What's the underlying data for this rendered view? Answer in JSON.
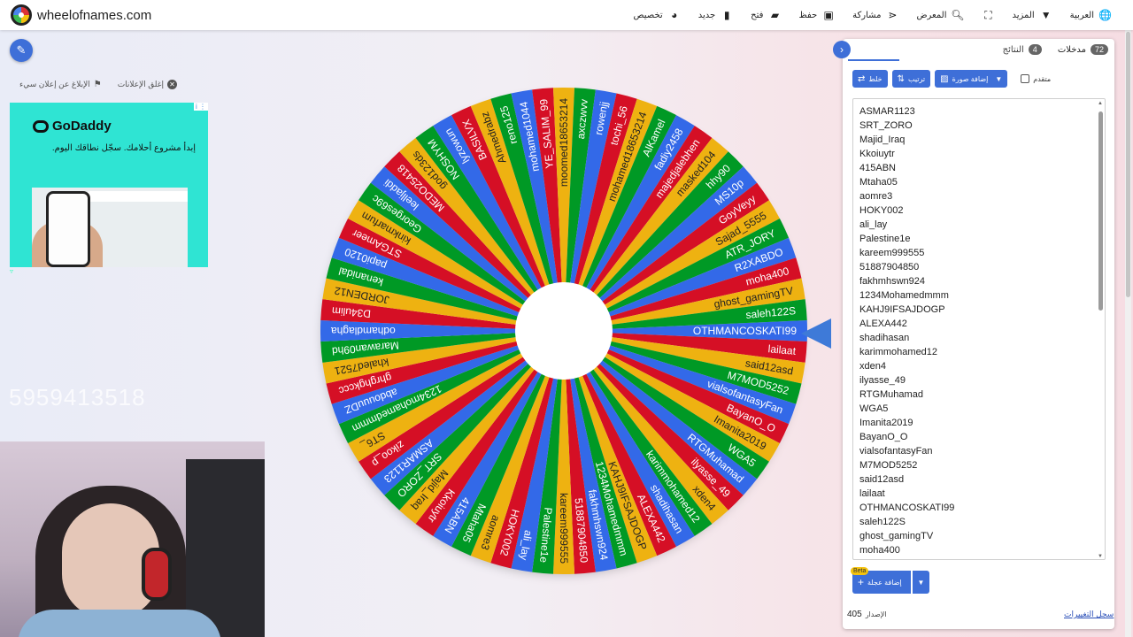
{
  "header": {
    "brand": "wheelofnames.com",
    "nav": [
      {
        "label": "العربية",
        "icon": "globe-icon",
        "dropdown": false
      },
      {
        "label": "المزيد",
        "icon": "caret-down-icon",
        "dropdown": true
      },
      {
        "label": "",
        "icon": "fullscreen-icon",
        "dropdown": false
      },
      {
        "label": "المعرض",
        "icon": "search-icon",
        "dropdown": false
      },
      {
        "label": "مشاركة",
        "icon": "share-icon",
        "dropdown": false
      },
      {
        "label": "حفظ",
        "icon": "save-icon",
        "dropdown": false
      },
      {
        "label": "فتح",
        "icon": "folder-open-icon",
        "dropdown": false
      },
      {
        "label": "جديد",
        "icon": "new-file-icon",
        "dropdown": false
      },
      {
        "label": "تخصيص",
        "icon": "palette-icon",
        "dropdown": false
      }
    ]
  },
  "left": {
    "close_ads": "إغلق الإعلانات",
    "report_ad": "الإبلاغ عن إعلان سيء",
    "ad": {
      "brand": "GoDaddy",
      "text": "إبدأ مشروع أحلامك. سجّل نطاقك اليوم.",
      "corner": "i ⋮"
    },
    "faded_number": "5959413518"
  },
  "wheel": {
    "colors": [
      "#3369e8",
      "#d50f25",
      "#eeb211",
      "#009925"
    ],
    "center_color": "#ffffff",
    "pointer_color": "#3e7ad8",
    "segments": [
      "OTHMANCOSKATI99",
      "lailaat",
      "said12asd",
      "M7MOD5252",
      "vialsofantasyFan",
      "BayanO_O",
      "Imanita2019",
      "WGA5",
      "RTGMuhamad",
      "ilyasse_49",
      "xden4",
      "karimmohamed12",
      "shadihasan",
      "ALEXA442",
      "KAHJ9IFSAJDOGP",
      "1234Mohamedmmm",
      "fakhmhswn924",
      "51887904850",
      "kareem999555",
      "Palestine1e",
      "ali_lay",
      "HOKY002",
      "aomre3",
      "Mtaha05",
      "415ABN",
      "Kkoiuytr",
      "Majid_Iraq",
      "SRT_ZORO",
      "ASMAR1123",
      "zikoo_p",
      "ST6_",
      "1234mohamedmmm",
      "abdouuuDZ",
      "ghrghgkccc",
      "khaled7521",
      "Marawan09hd",
      "odhamdlagha",
      "D34ulim",
      "JORDEN12",
      "kenanidal",
      "papi0120",
      "STGAmeer",
      "kinkmarfum",
      "Georges69c",
      "leelljaddi",
      "MEDO25418",
      "god123ds",
      "NOSHYM",
      "lyzowun",
      "BASILVX",
      "Ahmedrabz",
      "reno125",
      "mohamed1044",
      "YE_SALIM_99",
      "moomed18653214",
      "axczwvv",
      "rowenjj",
      "tochi_56",
      "mohamed18653214",
      "AlKamel",
      "fadiy2458",
      "majedjalebhen",
      "masked104",
      "hhy90",
      "MS10p",
      "GoyVeyy",
      "Sajad_5555",
      "ATR_JORY",
      "R2XABDO",
      "moha400",
      "ghost_gamingTV",
      "saleh122S"
    ]
  },
  "panel": {
    "tabs": [
      {
        "label": "مدخلات",
        "count": "72",
        "active": true
      },
      {
        "label": "النتائج",
        "count": "4",
        "active": false
      }
    ],
    "buttons": {
      "shuffle": "خلط",
      "sort": "ترتيب",
      "add_image": "إضافة صورة",
      "advanced": "متقدم",
      "add_wheel": "إضافة عجلة",
      "beta": "Beta"
    },
    "entries": [
      "ASMAR1123",
      "SRT_ZORO",
      "Majid_Iraq",
      "Kkoiuytr",
      "415ABN",
      "Mtaha05",
      "aomre3",
      "HOKY002",
      "ali_lay",
      "Palestine1e",
      "kareem999555",
      "51887904850",
      "fakhmhswn924",
      "1234Mohamedmmm",
      "KAHJ9IFSAJDOGP",
      "ALEXA442",
      "shadihasan",
      "karimmohamed12",
      "xden4",
      "ilyasse_49",
      "RTGMuhamad",
      "WGA5",
      "Imanita2019",
      "BayanO_O",
      "vialsofantasyFan",
      "M7MOD5252",
      "said12asd",
      "lailaat",
      "OTHMANCOSKATI99",
      "saleh122S",
      "ghost_gamingTV",
      "moha400",
      "R2XABDO"
    ],
    "version_label": "الإصدار",
    "version": "405",
    "changelog": "سجل التغييرات"
  }
}
